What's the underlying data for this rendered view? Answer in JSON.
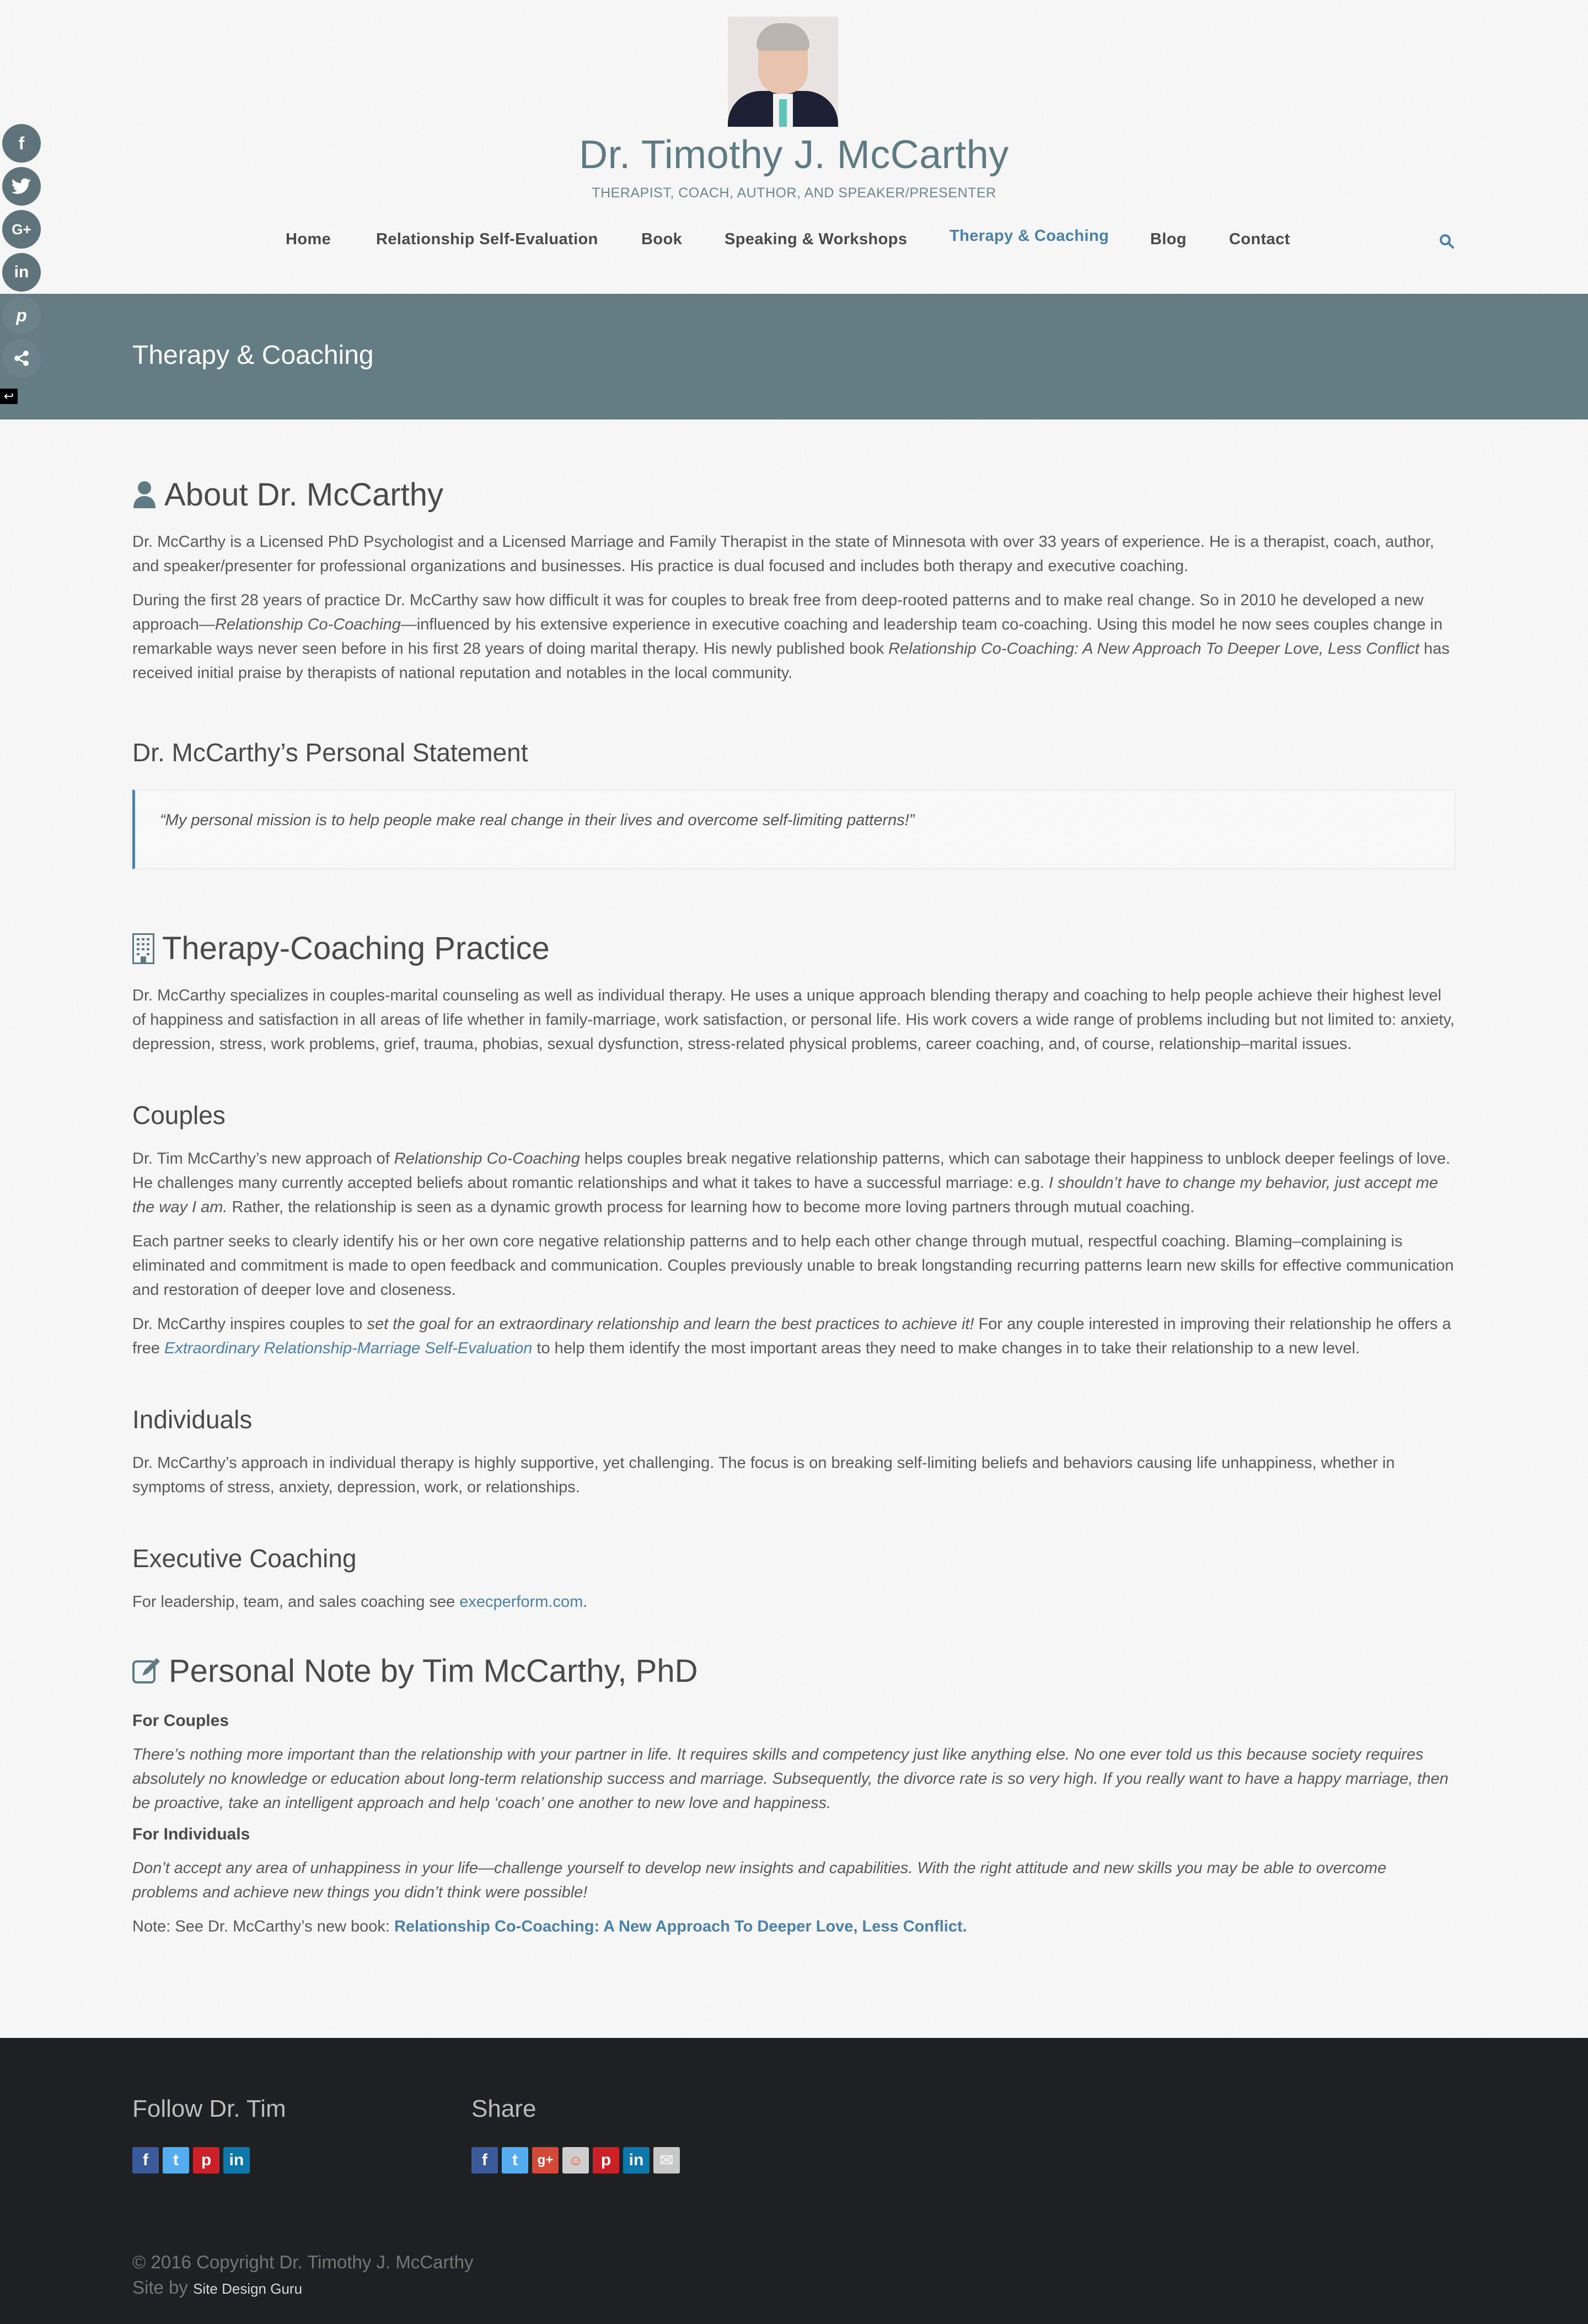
{
  "header": {
    "site_title": "Dr. Timothy J. McCarthy",
    "tagline": "THERAPIST, COACH, AUTHOR, AND SPEAKER/PRESENTER",
    "portrait_alt": "Portrait of Dr. Timothy J. McCarthy"
  },
  "nav": {
    "items": [
      {
        "label": "Home",
        "active": false
      },
      {
        "label": "Relationship Self-Evaluation",
        "active": false
      },
      {
        "label": "Book",
        "active": false
      },
      {
        "label": "Speaking & Workshops",
        "active": false
      },
      {
        "label": "Therapy & Coaching",
        "active": true
      },
      {
        "label": "Blog",
        "active": false
      },
      {
        "label": "Contact",
        "active": false
      }
    ],
    "search_icon": "search-icon"
  },
  "social_float": {
    "items": [
      "facebook",
      "twitter",
      "google-plus",
      "linkedin",
      "pinterest",
      "share"
    ],
    "collapse_icon": "arrow-return-icon"
  },
  "page_title": "Therapy & Coaching",
  "colors": {
    "accent": "#4b80a8",
    "band": "#647d84",
    "title": "#5e7a82",
    "footer_bg": "#1f2022"
  },
  "about": {
    "heading": "About Dr. McCarthy",
    "p1": "Dr. McCarthy is a Licensed PhD Psychologist and a Licensed Marriage and Family Therapist in the state of Minnesota with over 33 years of experience. He is a therapist, coach, author, and speaker/presenter for professional organizations and businesses. His practice is dual focused and includes both therapy and executive coaching.",
    "p2_a": "During the first 28 years of practice Dr. McCarthy saw how difficult it was for couples to break free from deep-rooted patterns and to make real change. So in 2010 he developed a new approach—",
    "p2_em1": "Relationship Co-Coaching",
    "p2_b": "—influenced by his extensive experience in executive coaching and leadership team co-coaching. Using this model he now sees couples change in remarkable ways never seen before in his first 28 years of doing marital therapy. His newly published book ",
    "p2_em2": "Relationship Co-Coaching: A New Approach To Deeper Love, Less Conflict",
    "p2_c": " has received initial praise by therapists of national reputation and notables in the local community."
  },
  "statement": {
    "heading": "Dr. McCarthy’s Personal Statement",
    "quote": "“My personal mission is to help people make real change in their lives and overcome self-limiting patterns!”"
  },
  "practice": {
    "heading": "Therapy-Coaching Practice",
    "p1": "Dr. McCarthy specializes in couples-marital counseling as well as individual therapy. He uses a unique approach blending therapy and coaching to help people achieve their highest level of happiness and satisfaction in all areas of life whether in family-marriage, work satisfaction, or personal life. His work covers a wide range of problems including but not limited to: anxiety, depression, stress, work problems, grief, trauma, phobias, sexual dysfunction, stress-related physical problems, career coaching, and, of course, relationship–marital issues."
  },
  "couples": {
    "heading": "Couples",
    "p1_a": "Dr. Tim McCarthy’s new approach of ",
    "p1_em1": "Relationship Co-Coaching",
    "p1_b": " helps couples break negative relationship patterns, which can sabotage their happiness to unblock deeper feelings of love. He challenges many currently accepted beliefs about romantic relationships and what it takes to have a successful marriage: e.g. ",
    "p1_em2": "I shouldn’t have to change my behavior, just accept me the way I am.",
    "p1_c": " Rather, the relationship is seen as a dynamic growth process for learning how to become more loving partners through mutual coaching.",
    "p2": "Each partner seeks to clearly identify his or her own core negative relationship patterns and to help each other change through mutual, respectful coaching. Blaming–complaining is eliminated and commitment is made to open feedback and communication. Couples previously unable to break longstanding recurring patterns learn new skills for effective communication and restoration of deeper love and closeness.",
    "p3_a": "Dr. McCarthy inspires couples to ",
    "p3_em": "set the goal for an extraordinary relationship and learn the best practices to achieve it!",
    "p3_b": " For any couple interested in improving their relationship he offers a free ",
    "p3_link": "Extraordinary Relationship-Marriage Self-Evaluation",
    "p3_c": " to help them identify the most important areas they need to make changes in to take their relationship to a new level."
  },
  "individuals": {
    "heading": "Individuals",
    "p1": "Dr. McCarthy’s approach in individual therapy is highly supportive, yet challenging. The focus is on breaking self-limiting beliefs and behaviors causing life unhappiness, whether in symptoms of stress, anxiety, depression, work, or relationships."
  },
  "executive": {
    "heading": "Executive Coaching",
    "p1_a": "For leadership, team, and sales coaching see ",
    "p1_link": "execperform.com",
    "p1_b": "."
  },
  "note": {
    "heading": "Personal Note by Tim McCarthy, PhD",
    "couples_heading": "For Couples",
    "couples_text": "There’s nothing more important than the relationship with your partner in life. It requires skills and competency just like anything else. No one ever told us this because society requires absolutely no knowledge or education about long-term relationship success and marriage. Subsequently, the divorce rate is so very high. If you really want to have a happy marriage, then be proactive, take an intelligent approach and help ‘coach’ one another to new love and happiness.",
    "individuals_heading": "For Individuals",
    "individuals_text": "Don’t accept any area of unhappiness in your life—challenge yourself to develop new insights and capabilities. With the right attitude and new skills you may be able to overcome problems and achieve new things you didn’t think were possible!",
    "book_prefix": "Note: See Dr. McCarthy’s new book: ",
    "book_link": "Relationship Co-Coaching: A New Approach To Deeper Love, Less Conflict."
  },
  "footer": {
    "follow_heading": "Follow Dr. Tim",
    "follow_icons": [
      "facebook",
      "twitter",
      "pinterest",
      "linkedin"
    ],
    "share_heading": "Share",
    "share_icons": [
      "facebook",
      "twitter",
      "google-plus",
      "reddit",
      "pinterest",
      "linkedin",
      "email"
    ],
    "copyright": "© 2016 Copyright Dr. Timothy J. McCarthy",
    "site_by_prefix": "Site by ",
    "site_by_link": "Site Design Guru"
  }
}
